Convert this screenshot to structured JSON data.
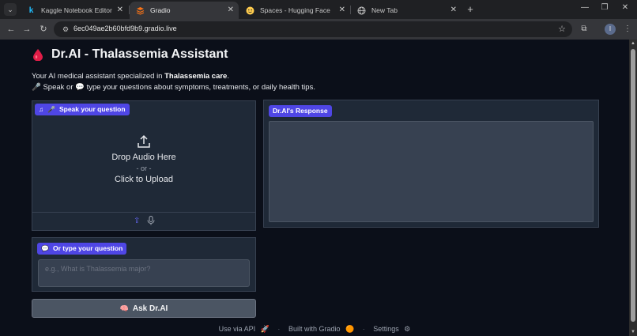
{
  "browser": {
    "tabs": [
      {
        "title": "Kaggle Notebook Editor",
        "favicon": "kaggle-k-icon"
      },
      {
        "title": "Gradio",
        "favicon": "gradio-icon",
        "active": true
      },
      {
        "title": "Spaces - Hugging Face",
        "favicon": "hugging-face-icon"
      },
      {
        "title": "New Tab",
        "favicon": "globe-icon"
      }
    ],
    "url": "6ec049ae2b60bfd9b9.gradio.live",
    "profile_initial": "I"
  },
  "app": {
    "title": "Dr.AI - Thalassemia Assistant",
    "desc_prefix": "Your AI medical assistant specialized in ",
    "desc_bold": "Thalassemia care",
    "desc_suffix": ".",
    "desc_line2": "🎤 Speak or 💬 type your questions about symptoms, treatments, or daily health tips."
  },
  "audio_input": {
    "label": "Speak your question",
    "drop_text": "Drop Audio Here",
    "or_text": "- or -",
    "click_text": "Click to Upload"
  },
  "text_input": {
    "label": "Or type your question",
    "placeholder": "e.g., What is Thalassemia major?",
    "value": ""
  },
  "ask_button": {
    "label": "Ask Dr.AI"
  },
  "response": {
    "label": "Dr.AI's Response",
    "value": ""
  },
  "footer": {
    "api": "Use via API",
    "built": "Built with Gradio",
    "settings": "Settings"
  },
  "colors": {
    "background": "#0b0f19",
    "panel": "#1f2937",
    "accent": "#4f46e5",
    "button": "#4b5563"
  }
}
